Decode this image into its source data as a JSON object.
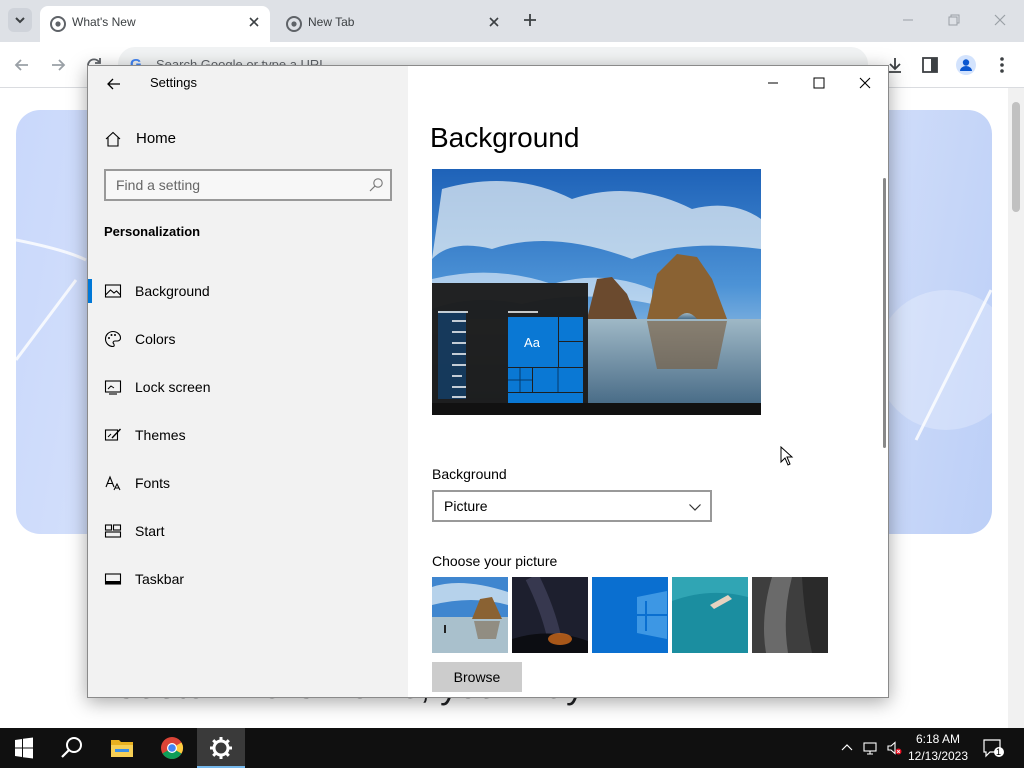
{
  "browser": {
    "tabs": [
      {
        "title": "What's New",
        "active": true
      },
      {
        "title": "New Tab",
        "active": false
      }
    ],
    "omnibox_placeholder": "Search Google or type a URL",
    "omnibox_logo": "G",
    "page_heading": "Customize Chrome, your way"
  },
  "settings": {
    "window_title": "Settings",
    "home_label": "Home",
    "search_placeholder": "Find a setting",
    "section_title": "Personalization",
    "nav_items": [
      {
        "label": "Background",
        "icon": "picture-icon",
        "selected": true
      },
      {
        "label": "Colors",
        "icon": "palette-icon",
        "selected": false
      },
      {
        "label": "Lock screen",
        "icon": "lock-screen-icon",
        "selected": false
      },
      {
        "label": "Themes",
        "icon": "themes-icon",
        "selected": false
      },
      {
        "label": "Fonts",
        "icon": "fonts-icon",
        "selected": false
      },
      {
        "label": "Start",
        "icon": "start-icon",
        "selected": false
      },
      {
        "label": "Taskbar",
        "icon": "taskbar-icon",
        "selected": false
      }
    ],
    "page_title": "Background",
    "preview_tile_text": "Aa",
    "background_label": "Background",
    "background_value": "Picture",
    "choose_picture_label": "Choose your picture",
    "browse_label": "Browse",
    "accent_color": "#0078d7"
  },
  "taskbar": {
    "apps": [
      "start-icon",
      "search-icon",
      "file-explorer-icon",
      "chrome-icon",
      "settings-icon"
    ],
    "time": "6:18 AM",
    "date": "12/13/2023",
    "notification_count": "1"
  }
}
